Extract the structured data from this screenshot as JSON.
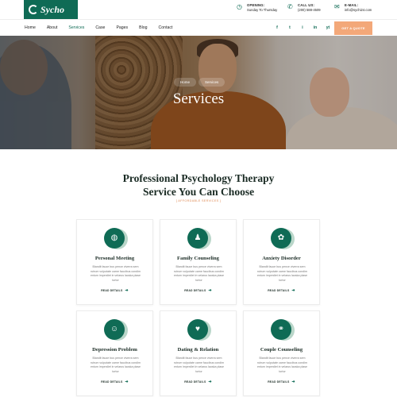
{
  "brand": {
    "name": "Sycho",
    "accent": "#0f6b55",
    "cta_color": "#f3a879"
  },
  "topbar": {
    "opening": {
      "label": "OPENING:",
      "value": "Sunday To Thursday",
      "icon": "clock-icon"
    },
    "call": {
      "label": "CALL US:",
      "value": "(200) 588-4509",
      "icon": "phone-icon"
    },
    "email": {
      "label": "E-MAIL:",
      "value": "info@sychi24.com",
      "icon": "mail-icon"
    }
  },
  "nav": {
    "items": [
      "Home",
      "About",
      "Services",
      "Case",
      "Pages",
      "Blog",
      "Contact"
    ],
    "active": "Services",
    "socials": [
      "f",
      "t",
      "i",
      "in",
      "yt"
    ],
    "cta": "GET A QUOTE"
  },
  "hero": {
    "breadcrumb": [
      "Home",
      "Services"
    ],
    "title": "Services"
  },
  "section": {
    "title_line1": "Professional Psychology Therapy",
    "title_line2": "Service You Can Choose",
    "tag": "[ AFFORDABLE SERVICES ]"
  },
  "cards": [
    {
      "title": "Personal Meeting",
      "desc": "Blandit fauce bus pence viverra sem rutrum vulputate carne faucibus condim entum imperdiet in velarus laoska plase tortor",
      "link": "READ DETAILS",
      "icon": "handshake-icon"
    },
    {
      "title": "Family Counseling",
      "desc": "Blandit fauce bus pence viverra sem rutrum vulputate carne faucibus condim entum imperdiet in velarus laoska plase tortor",
      "link": "READ DETAILS",
      "icon": "family-icon"
    },
    {
      "title": "Anxiety Disorder",
      "desc": "Blandit fauce bus pence viverra sem rutrum vulputate carne faucibus condim entum imperdiet in velarus laoska plase tortor",
      "link": "READ DETAILS",
      "icon": "brain-icon"
    },
    {
      "title": "Depression Problem",
      "desc": "Blandit fauce bus pence viverra sem rutrum vulputate carne faucibus condim entum imperdiet in velarus laoska plase tortor",
      "link": "READ DETAILS",
      "icon": "head-gear-icon"
    },
    {
      "title": "Dating & Relation",
      "desc": "Blandit fauce bus pence viverra sem rutrum vulputate carne faucibus condim entum imperdiet in velarus laoska plase tortor",
      "link": "READ DETAILS",
      "icon": "heart-hand-icon"
    },
    {
      "title": "Couple Counseling",
      "desc": "Blandit fauce bus pence viverra sem rutrum vulputate carne faucibus condim entum imperdiet in velarus laoska plase tortor",
      "link": "READ DETAILS",
      "icon": "couple-icon"
    }
  ]
}
